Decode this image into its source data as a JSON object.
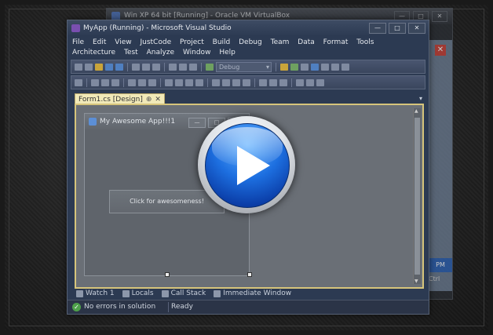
{
  "virtualbox": {
    "title": "Win XP 64 bit [Running] - Oracle VM VirtualBox",
    "buttons": [
      "—",
      "□",
      "✕"
    ],
    "close_glyph": "✕",
    "clock_fragment": "PM",
    "ctrl_fragment": "Ctrl"
  },
  "vs": {
    "title": "MyApp (Running) - Microsoft Visual Studio",
    "window_buttons": [
      "—",
      "□",
      "✕"
    ],
    "menu": [
      "File",
      "Edit",
      "View",
      "JustCode",
      "Project",
      "Build",
      "Debug",
      "Team",
      "Data",
      "Format",
      "Tools",
      "Architecture",
      "Test",
      "Analyze",
      "Window",
      "Help"
    ],
    "config_select": "Debug",
    "doc_tab": {
      "label": "Form1.cs [Design]",
      "pin": "⊕",
      "close": "✕"
    },
    "doc_dropdown": "▾",
    "bottom_tabs": [
      {
        "label": "Watch 1",
        "icon": "watch-icon"
      },
      {
        "label": "Locals",
        "icon": "locals-icon"
      },
      {
        "label": "Call Stack",
        "icon": "call-stack-icon"
      },
      {
        "label": "Immediate Window",
        "icon": "immediate-window-icon"
      }
    ],
    "status": {
      "message": "No errors in solution",
      "ready": "Ready",
      "check": "✓"
    }
  },
  "form": {
    "title": "My Awesome App!!!1",
    "buttons": [
      "—",
      "□",
      "✕"
    ],
    "button_label": "Click for awesomeness!"
  },
  "overlay": {
    "icon": "play-icon",
    "color": "#1d6fe0"
  }
}
